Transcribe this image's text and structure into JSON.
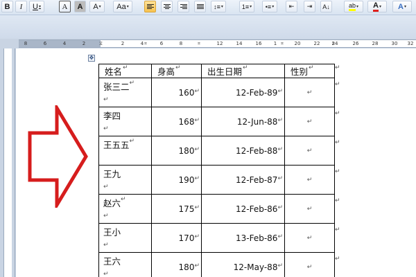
{
  "colors": {
    "arrow": "#d61d1d",
    "accent": "#f7c24f"
  },
  "toolbar": {
    "buttons": [
      {
        "label": "B",
        "icon": "bold-icon"
      },
      {
        "label": "I",
        "icon": "italic-icon"
      },
      {
        "label": "U",
        "icon": "underline-icon"
      },
      {
        "label": "A",
        "icon": "char-border-icon"
      },
      {
        "label": "A",
        "icon": "char-shading-icon"
      },
      {
        "label": "A",
        "icon": "clear-format-icon"
      },
      {
        "label": "Aa",
        "icon": "change-case-icon"
      },
      {
        "label": "",
        "icon": "align-left-icon"
      },
      {
        "label": "",
        "icon": "align-center-icon"
      },
      {
        "label": "",
        "icon": "align-right-icon"
      },
      {
        "label": "",
        "icon": "justify-icon"
      },
      {
        "label": "",
        "icon": "line-spacing-icon"
      },
      {
        "label": "",
        "icon": "numbering-icon"
      },
      {
        "label": "",
        "icon": "bullets-icon"
      },
      {
        "label": "",
        "icon": "decrease-indent-icon"
      },
      {
        "label": "",
        "icon": "sort-icon"
      },
      {
        "label": "ab",
        "icon": "highlight-icon"
      },
      {
        "label": "A",
        "icon": "font-color-icon"
      },
      {
        "label": "A",
        "icon": "text-effects-icon"
      }
    ]
  },
  "ruler": {
    "numbers": [
      "8",
      "6",
      "4",
      "2",
      "2",
      "4",
      "6",
      "8",
      "12",
      "14",
      "16",
      "1",
      "20",
      "22",
      "24",
      "26",
      "28",
      "30",
      "32"
    ]
  },
  "table": {
    "headers": [
      "姓名",
      "身高",
      "出生日期",
      "性别"
    ],
    "rows": [
      {
        "name": "张三二",
        "height": "160",
        "dob": "12-Feb-89",
        "gender": ""
      },
      {
        "name": "李四",
        "height": "168",
        "dob": "12-Jun-88",
        "gender": ""
      },
      {
        "name": "王五五",
        "height": "180",
        "dob": "12-Feb-88",
        "gender": ""
      },
      {
        "name": "王九",
        "height": "190",
        "dob": "12-Feb-87",
        "gender": ""
      },
      {
        "name": "赵六",
        "height": "175",
        "dob": "12-Feb-86",
        "gender": ""
      },
      {
        "name": "王小",
        "height": "170",
        "dob": "13-Feb-86",
        "gender": ""
      },
      {
        "name": "王六",
        "height": "180",
        "dob": "12-May-88",
        "gender": ""
      }
    ]
  },
  "marks": {
    "cell_end": "↵"
  },
  "annotation": {
    "icon": "red-arrow-icon"
  }
}
